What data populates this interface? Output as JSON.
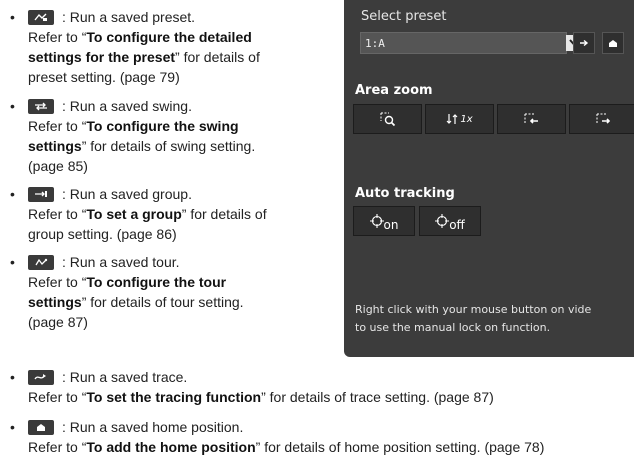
{
  "items": [
    {
      "icon": "preset-run-icon",
      "desc": ": Run a saved preset.",
      "refer_pre": "Refer to “",
      "bold_1": "To configure the detailed",
      "bold_2": "settings for the preset",
      "refer_post": "” for details of",
      "tail": "preset setting. (page 79)"
    },
    {
      "icon": "swing-run-icon",
      "desc": ": Run a saved swing.",
      "refer_pre": "Refer to “",
      "bold_1": "To configure the swing",
      "bold_2": "settings",
      "refer_post": "” for details of swing setting.",
      "tail": "(page 85)"
    },
    {
      "icon": "group-run-icon",
      "desc": ": Run a saved group.",
      "refer_pre": "Refer to “",
      "bold_1": "To set a group",
      "refer_post": "” for details of",
      "tail": "group setting. (page 86)"
    },
    {
      "icon": "tour-run-icon",
      "desc": ": Run a saved tour.",
      "refer_pre": "Refer to “",
      "bold_1": "To configure the tour",
      "bold_2": "settings",
      "refer_post": "” for details of tour setting.",
      "tail": "(page 87)"
    },
    {
      "icon": "trace-run-icon",
      "desc": ": Run a saved trace.",
      "refer_pre": "Refer to “",
      "bold_1": "To set the tracing function",
      "refer_post": "” for details of trace setting. (page 87)"
    },
    {
      "icon": "home-run-icon",
      "desc": ": Run a saved home position.",
      "refer_pre": "Refer to “",
      "bold_1": "To add the home position",
      "refer_post": "” for details of home position setting. (page 78)"
    }
  ],
  "bullet": "•",
  "panel": {
    "select_label": "Select preset",
    "select_value": "1:A",
    "area_zoom_label": "Area zoom",
    "zoom_1x_label": "1x",
    "auto_tracking_label": "Auto tracking",
    "on_label": "on",
    "off_label": "off",
    "footer_line1": "Right click with your mouse button on vide",
    "footer_line2": "to use the manual lock on function."
  }
}
